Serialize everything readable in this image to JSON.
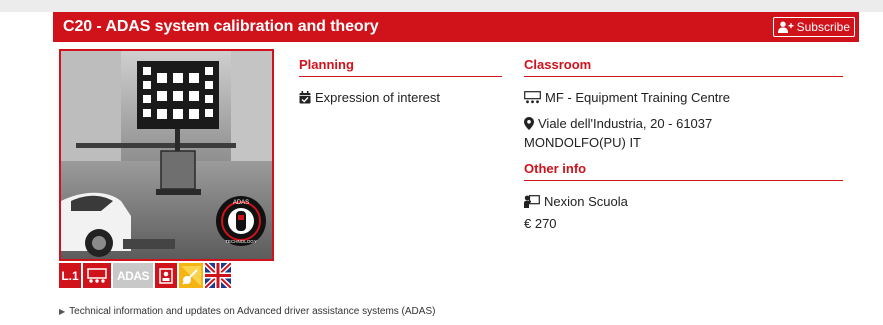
{
  "course": {
    "title": "C20 - ADAS system calibration and theory",
    "subscribe_label": "Subscribe"
  },
  "planning": {
    "heading": "Planning",
    "value": "Expression of interest"
  },
  "classroom": {
    "heading": "Classroom",
    "name": "MF - Equipment Training Centre",
    "address_line1": "Viale dell'Industria, 20 - 61037",
    "address_line2": "MONDOLFO(PU) IT"
  },
  "other_info": {
    "heading": "Other info",
    "type": "Nexion Scuola",
    "price": "€ 270"
  },
  "badges": {
    "level": "L.1",
    "adas": "ADAS"
  },
  "photo": {
    "seal_text": "ADAS TECHNOLOGY"
  },
  "footer": {
    "note": "Technical information and updates on Advanced driver assistance systems (ADAS)"
  },
  "colors": {
    "brand": "#d0121b",
    "sun_badge": "#f6b413",
    "adas_badge": "#c8c8c8"
  }
}
